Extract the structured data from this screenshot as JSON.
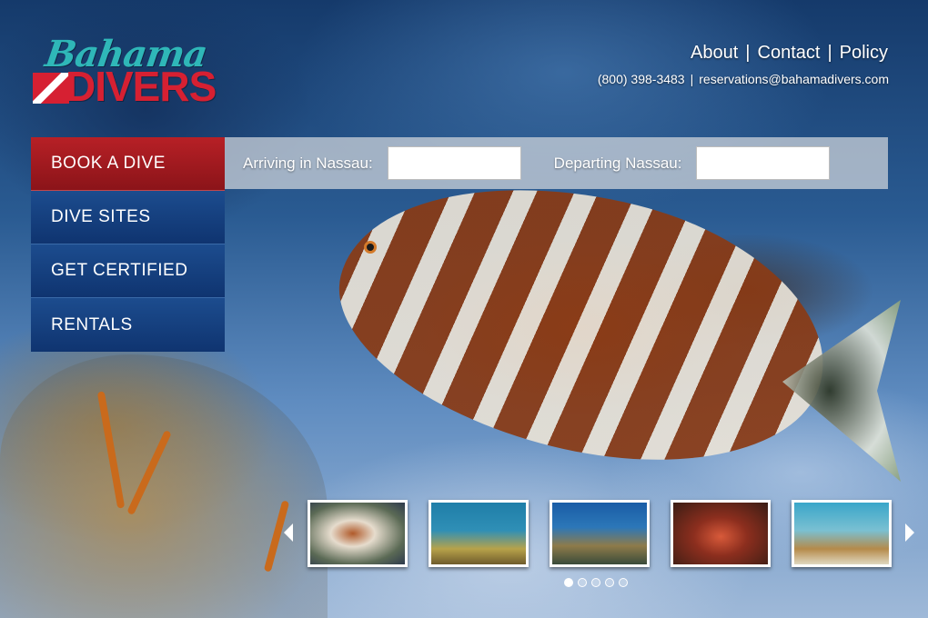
{
  "logo": {
    "script_text": "Bahama",
    "word_text": "DIVERS",
    "colors": {
      "script": "#2fb7b8",
      "word": "#d62032"
    }
  },
  "top_nav": {
    "links": [
      "About",
      "Contact",
      "Policy"
    ],
    "separator": "|"
  },
  "contact": {
    "phone": "(800) 398-3483",
    "separator": "|",
    "email": "reservations@bahamadivers.com"
  },
  "menu": {
    "items": [
      {
        "label": "BOOK A DIVE",
        "active": true
      },
      {
        "label": "DIVE SITES",
        "active": false
      },
      {
        "label": "GET CERTIFIED",
        "active": false
      },
      {
        "label": "RENTALS",
        "active": false
      }
    ],
    "colors": {
      "active": "#b72026",
      "inactive": "#1c4c8e"
    }
  },
  "booking": {
    "arriving_label": "Arriving in Nassau:",
    "arriving_value": "",
    "departing_label": "Departing Nassau:",
    "departing_value": ""
  },
  "gallery": {
    "thumbnail_count": 5,
    "pagination_dots": 5,
    "active_dot": 1,
    "icons": [
      "chevron-left-icon",
      "chevron-right-icon"
    ]
  }
}
